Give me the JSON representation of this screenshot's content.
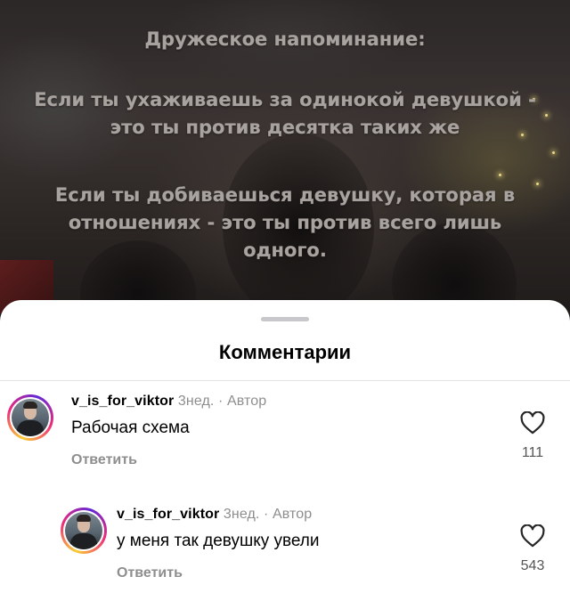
{
  "video": {
    "overlay_title": "Дружеское напоминание:",
    "overlay_paragraph_1": "Если ты ухаживаешь за одинокой девушкой - это ты против десятка таких же",
    "overlay_paragraph_2": "Если ты добиваешься девушку, которая в отношениях - это ты против всего лишь одного."
  },
  "sheet": {
    "title": "Комментарии"
  },
  "comments": [
    {
      "username": "v_is_for_viktor",
      "meta": "3нед. · Автор",
      "text": "Рабочая схема",
      "reply_label": "Ответить",
      "likes": "111"
    },
    {
      "username": "v_is_for_viktor",
      "meta": "3нед. · Автор",
      "text": "у меня так девушку увели",
      "reply_label": "Ответить",
      "likes": "543"
    }
  ],
  "icons": {
    "like": "heart-outline-icon",
    "avatar": "profile-photo"
  }
}
